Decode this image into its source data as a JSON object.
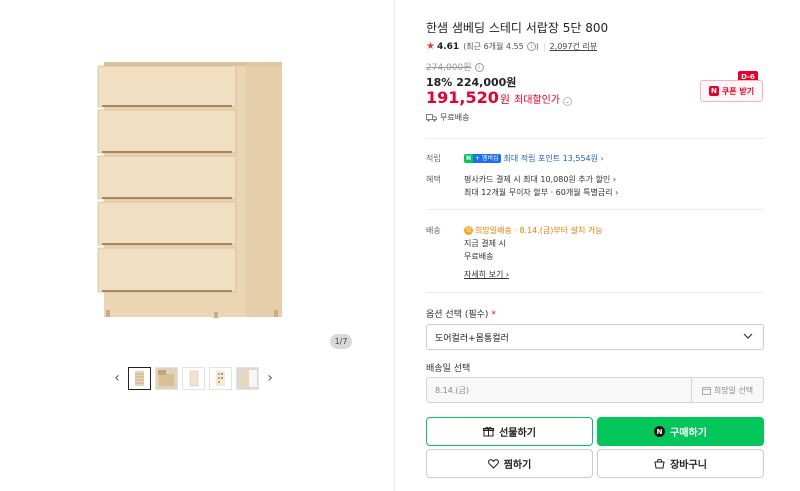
{
  "product": {
    "title": "한샘 샘베딩 스테디 서랍장 5단 800",
    "rating": "4.61",
    "rating_detail": "(최근 6개월 4.55",
    "rating_detail_close": ")",
    "review_count": "2,097건 리뷰",
    "original_price": "274,000원",
    "discount_rate": "18%",
    "sale_price": "224,000원",
    "max_discount_price": "191,520",
    "max_discount_won": "원",
    "max_discount_label": "최대할인가",
    "free_shipping": "무료배송",
    "coupon_label": "쿠폰 받기",
    "coupon_tag": "D-6",
    "coupon_n": "N"
  },
  "gallery": {
    "page_indicator": "1/7",
    "prev_label": "‹",
    "next_label": "›"
  },
  "benefits": {
    "points_label": "적립",
    "points_n": "N",
    "points_plus": "+ 멤버십",
    "points_text": "최대 적립 포인트 13,554원 ›",
    "perks_label": "혜택",
    "perk_1": "평사카드 결제 시 최대 10,080원 추가 할인 ›",
    "perk_2": "최대 12개월 무이자 할부 · 60개월 특별금리 ›"
  },
  "delivery": {
    "label": "배송",
    "hope_badge": "희",
    "hope_text": "희망일배송",
    "hope_date": " · 8.14.(금)부터 설치 가능",
    "line_2": "지금 결제 시",
    "line_3": "무료배송",
    "detail_link": "자세히 보기 ›"
  },
  "options": {
    "option_label": "옵션 선택 (필수)",
    "required_mark": "*",
    "option_value": "도어컬러+몸통컬러",
    "date_label": "배송일 선택",
    "date_placeholder": "8.14.(금)",
    "date_button": "희망일 선택"
  },
  "actions": {
    "gift": "선물하기",
    "buy": "구매하기",
    "buy_n": "N",
    "wish": "찜하기",
    "cart": "장바구니"
  },
  "colors": {
    "accent_red": "#e8002b",
    "naver_green": "#03c75a",
    "link_blue": "#1e5fd6",
    "wood": "#ead5b4"
  }
}
